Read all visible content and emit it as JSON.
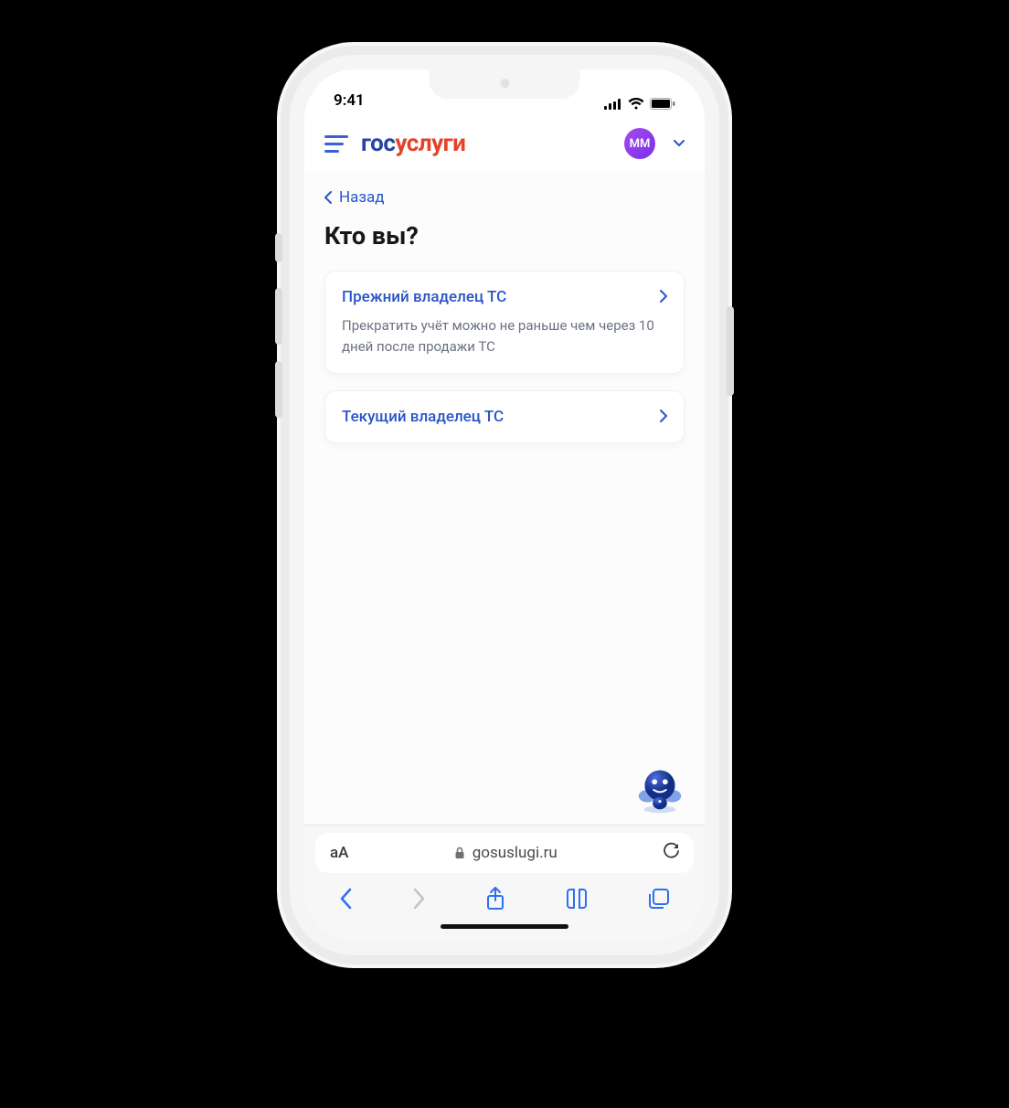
{
  "status": {
    "time": "9:41"
  },
  "header": {
    "logo_part1": "гос",
    "logo_part2": "услуги",
    "avatar_initials": "ММ"
  },
  "nav": {
    "back_label": "Назад"
  },
  "page": {
    "title": "Кто вы?"
  },
  "options": [
    {
      "title": "Прежний владелец ТС",
      "desc": "Прекратить учёт можно не раньше чем через 10 дней после продажи ТС"
    },
    {
      "title": "Текущий владелец ТС",
      "desc": ""
    }
  ],
  "safari": {
    "text_size_label": "аА",
    "domain": "gosuslugi.ru"
  }
}
